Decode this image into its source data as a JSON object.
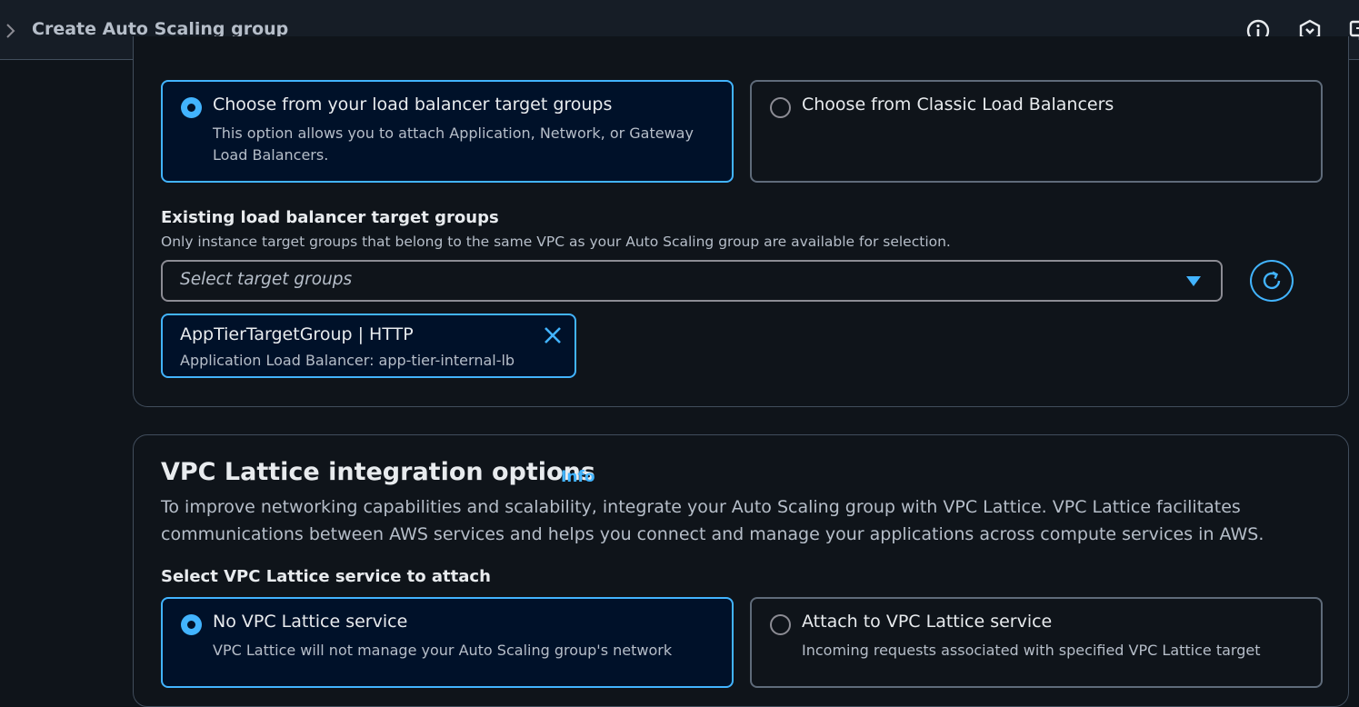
{
  "header": {
    "breadcrumb_title": "Create Auto Scaling group",
    "icons": [
      "chevron-right-icon",
      "info-circle-icon",
      "hexagon-icon",
      "monitor-icon"
    ]
  },
  "load_balancer_options": {
    "tiles": [
      {
        "title": "Choose from your load balancer target groups",
        "description": "This option allows you to attach Application, Network, or Gateway Load Balancers.",
        "selected": true
      },
      {
        "title": "Choose from Classic Load Balancers",
        "description": "",
        "selected": false
      }
    ],
    "target_groups": {
      "label": "Existing load balancer target groups",
      "description": "Only instance target groups that belong to the same VPC as your Auto Scaling group are available for selection.",
      "placeholder": "Select target groups",
      "selected": [
        {
          "name": "AppTierTargetGroup | HTTP",
          "detail": "Application Load Balancer: app-tier-internal-lb"
        }
      ]
    }
  },
  "vpc_lattice": {
    "heading": "VPC Lattice integration options",
    "info_label": "Info",
    "description": "To improve networking capabilities and scalability, integrate your Auto Scaling group with VPC Lattice. VPC Lattice facilitates communications between AWS services and helps you connect and manage your applications across compute services in AWS.",
    "select_label": "Select VPC Lattice service to attach",
    "tiles": [
      {
        "title": "No VPC Lattice service",
        "description": "VPC Lattice will not manage your Auto Scaling group's network",
        "selected": true
      },
      {
        "title": "Attach to VPC Lattice service",
        "description": "Incoming requests associated with specified VPC Lattice target",
        "selected": false
      }
    ]
  },
  "colors": {
    "background": "#0f141a",
    "accent": "#42b4ff",
    "selected_tile_bg": "#001129",
    "border": "#414d5c",
    "muted_text": "#b6bec9"
  }
}
